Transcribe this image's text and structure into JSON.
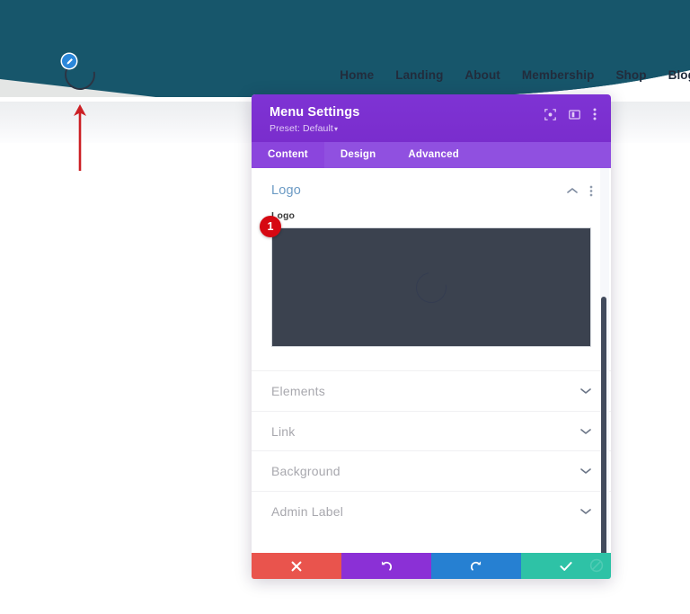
{
  "site": {
    "hero_color": "#17566b",
    "hero_accent_color": "#e4e6e5",
    "logo_name": "circle-arc-logo",
    "edit_badge_icon": "pencil-icon",
    "edit_badge_color": "#2b87da",
    "nav": [
      {
        "label": "Home"
      },
      {
        "label": "Landing"
      },
      {
        "label": "About"
      },
      {
        "label": "Membership"
      },
      {
        "label": "Shop"
      },
      {
        "label": "Blog"
      }
    ]
  },
  "annotation": {
    "arrow_color": "#cc1f24",
    "arrow_name": "red-up-arrow",
    "step_badge": "1",
    "step_badge_color": "#d60812"
  },
  "modal": {
    "title": "Menu Settings",
    "preset_label": "Preset: Default",
    "preset_caret": "▾",
    "header_color": "#7b2fd0",
    "header_icons": [
      {
        "name": "focus-target-icon"
      },
      {
        "name": "split-view-icon"
      },
      {
        "name": "more-vertical-icon"
      }
    ],
    "tabs": [
      {
        "label": "Content",
        "active": true
      },
      {
        "label": "Design",
        "active": false
      },
      {
        "label": "Advanced",
        "active": false
      }
    ],
    "section": {
      "title": "Logo",
      "collapse_icon": "chevron-up-icon",
      "menu_icon": "more-vertical-icon"
    },
    "field": {
      "label": "Logo",
      "preview_bg": "#3b424f",
      "preview_image_name": "circle-arc-logo-preview"
    },
    "accordions": [
      {
        "label": "Elements"
      },
      {
        "label": "Link"
      },
      {
        "label": "Background"
      },
      {
        "label": "Admin Label"
      }
    ],
    "footer": [
      {
        "name": "cancel-button",
        "icon": "close-icon",
        "color": "#e9544d"
      },
      {
        "name": "undo-button",
        "icon": "undo-icon",
        "color": "#8b30d6"
      },
      {
        "name": "redo-button",
        "icon": "redo-icon",
        "color": "#2680d2"
      },
      {
        "name": "save-button",
        "icon": "check-icon",
        "color": "#2ec2a6"
      }
    ]
  }
}
